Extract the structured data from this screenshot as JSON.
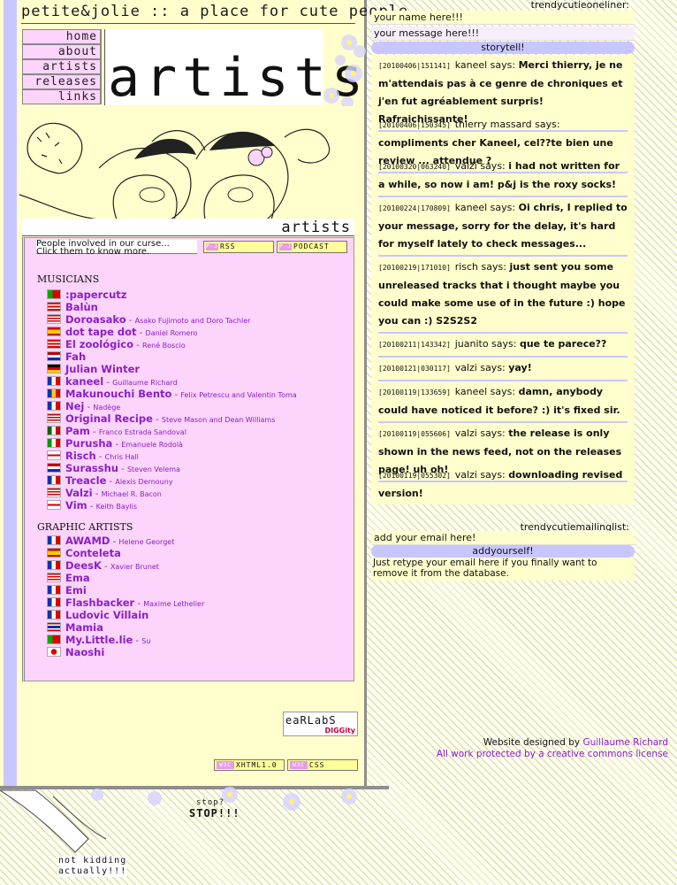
{
  "site": {
    "logo": "petite&jolie :: a place for cute people",
    "section_title": "artists",
    "section_bar_label": "artists"
  },
  "nav": [
    "home",
    "about",
    "artists",
    "releases",
    "links"
  ],
  "panel": {
    "intro_line1": "People involved in our curse...",
    "intro_line2": "Click them to know more.",
    "rss_label": "RSS",
    "podcast_label": "PODCAST",
    "musicians_heading": "MUSICIANS",
    "musicians": [
      {
        "name": ":papercutz",
        "members": "",
        "flag": "pt"
      },
      {
        "name": "Balùn",
        "members": "",
        "flag": "pr"
      },
      {
        "name": "Doroasako",
        "members": "Asako Fujimoto and Doro Tachler",
        "flag": "us"
      },
      {
        "name": "dot tape dot",
        "members": "Daniel Romero",
        "flag": "es"
      },
      {
        "name": "El zoológico",
        "members": "René Boscio",
        "flag": "pr"
      },
      {
        "name": "Fah",
        "members": "",
        "flag": "nl"
      },
      {
        "name": "Julian Winter",
        "members": "",
        "flag": "de"
      },
      {
        "name": "kaneel",
        "members": "Guillaume Richard",
        "flag": "fr"
      },
      {
        "name": "Makunouchi Bento",
        "members": "Felix Petrescu and Valentin Toma",
        "flag": "ro"
      },
      {
        "name": "Nej",
        "members": "Nadège",
        "flag": "fr"
      },
      {
        "name": "Original Recipe",
        "members": "Steve Mason and Dean Williams",
        "flag": "us"
      },
      {
        "name": "Pam",
        "members": "Franco Estrada Sandoval",
        "flag": "mx"
      },
      {
        "name": "Purusha",
        "members": "Emanuele Rodolà",
        "flag": "it"
      },
      {
        "name": "Risch",
        "members": "Chris Hall",
        "flag": "gb"
      },
      {
        "name": "Surasshu",
        "members": "Steven Velema",
        "flag": "nl"
      },
      {
        "name": "Treacle",
        "members": "Alexis Dernouny",
        "flag": "fr"
      },
      {
        "name": "Valzi",
        "members": "Michael R. Bacon",
        "flag": "us"
      },
      {
        "name": "Vim",
        "members": "Keith Baylis",
        "flag": "gb"
      }
    ],
    "graphic_heading": "GRAPHIC ARTISTS",
    "graphic": [
      {
        "name": "AWAMD",
        "members": "Helene Georget",
        "flag": "fr"
      },
      {
        "name": "Conteleta",
        "members": "",
        "flag": "es"
      },
      {
        "name": "DeesK",
        "members": "Xavier Brunet",
        "flag": "fr"
      },
      {
        "name": "Ema",
        "members": "",
        "flag": "us"
      },
      {
        "name": "Emi",
        "members": "",
        "flag": "fr"
      },
      {
        "name": "Flashbacker",
        "members": "Maxime Lethelier",
        "flag": "fr"
      },
      {
        "name": "Ludovic Villain",
        "members": "",
        "flag": "fr"
      },
      {
        "name": "Mamia",
        "members": "",
        "flag": "th"
      },
      {
        "name": "My.Little.lie",
        "members": "Su",
        "flag": "pt"
      },
      {
        "name": "Naoshi",
        "members": "",
        "flag": "jp"
      }
    ]
  },
  "footer": {
    "earlabs_logo": "eaRLabS",
    "earlabs_sub": "DIGGity",
    "designed_prefix": "Website designed by ",
    "designer": "Guillaume Richard",
    "license": "All work protected by a creative commons license",
    "badge1": "XHTML1.0",
    "badge2": "CSS",
    "w3c": "W3C"
  },
  "bottom": {
    "stop_small": "stop?",
    "stop_big": "STOP!!!",
    "not_kidding_1": "not kidding",
    "not_kidding_2": "actually!!!"
  },
  "oneliner": {
    "label": "trendycutieoneliner:",
    "name_placeholder": "your name here!!!",
    "message_placeholder": "your message here!!!",
    "submit": "storytell!",
    "messages": [
      {
        "ts": "[20100406|151141]",
        "who": "kaneel",
        "text": "Merci thierry, je ne m'attendais pas à ce genre de chroniques et j'en fut agréablement surpris! Rafraichissante!"
      },
      {
        "ts": "[20100406|150345]",
        "who": "thierry massard",
        "text": "compliments cher Kaneel, cel??te bien une review ... attendue ?"
      },
      {
        "ts": "[20100320|063240]",
        "who": "valzi",
        "text": "i had not written for a while, so now i am! p&j is the roxy socks!"
      },
      {
        "ts": "[20100224|170809]",
        "who": "kaneel",
        "text": "Oi chris, I replied to your message, sorry for the delay, it's hard for myself lately to check messages..."
      },
      {
        "ts": "[20100219|171010]",
        "who": "risch",
        "text": "just sent you some unreleased tracks that i thought maybe you could make some use of in the future :) hope you can :) S2S2S2"
      },
      {
        "ts": "[20100211|143342]",
        "who": "juanito",
        "text": "que te parece??"
      },
      {
        "ts": "[20100121|030117]",
        "who": "valzi",
        "text": "yay!"
      },
      {
        "ts": "[20100119|133659]",
        "who": "kaneel",
        "text": "damn, anybody could have noticed it before? :) it's fixed sir."
      },
      {
        "ts": "[20100119|055606]",
        "who": "valzi",
        "text": "the release is only shown in the news feed, not on the releases page! uh oh!"
      },
      {
        "ts": "[20100119|055302]",
        "who": "valzi",
        "text": "downloading revised version!"
      }
    ],
    "says": " says: "
  },
  "mailing": {
    "label": "trendycutiemailinglist:",
    "email_placeholder": "add your email here!",
    "submit": "addyourself!",
    "description": "Just retype your email here if you finally want to remove it from the database."
  },
  "colors": {
    "lavender": "#c8c6ff",
    "pink": "#fdd4fb",
    "cream": "#fffecc",
    "purple_link": "#8a1ec8"
  }
}
